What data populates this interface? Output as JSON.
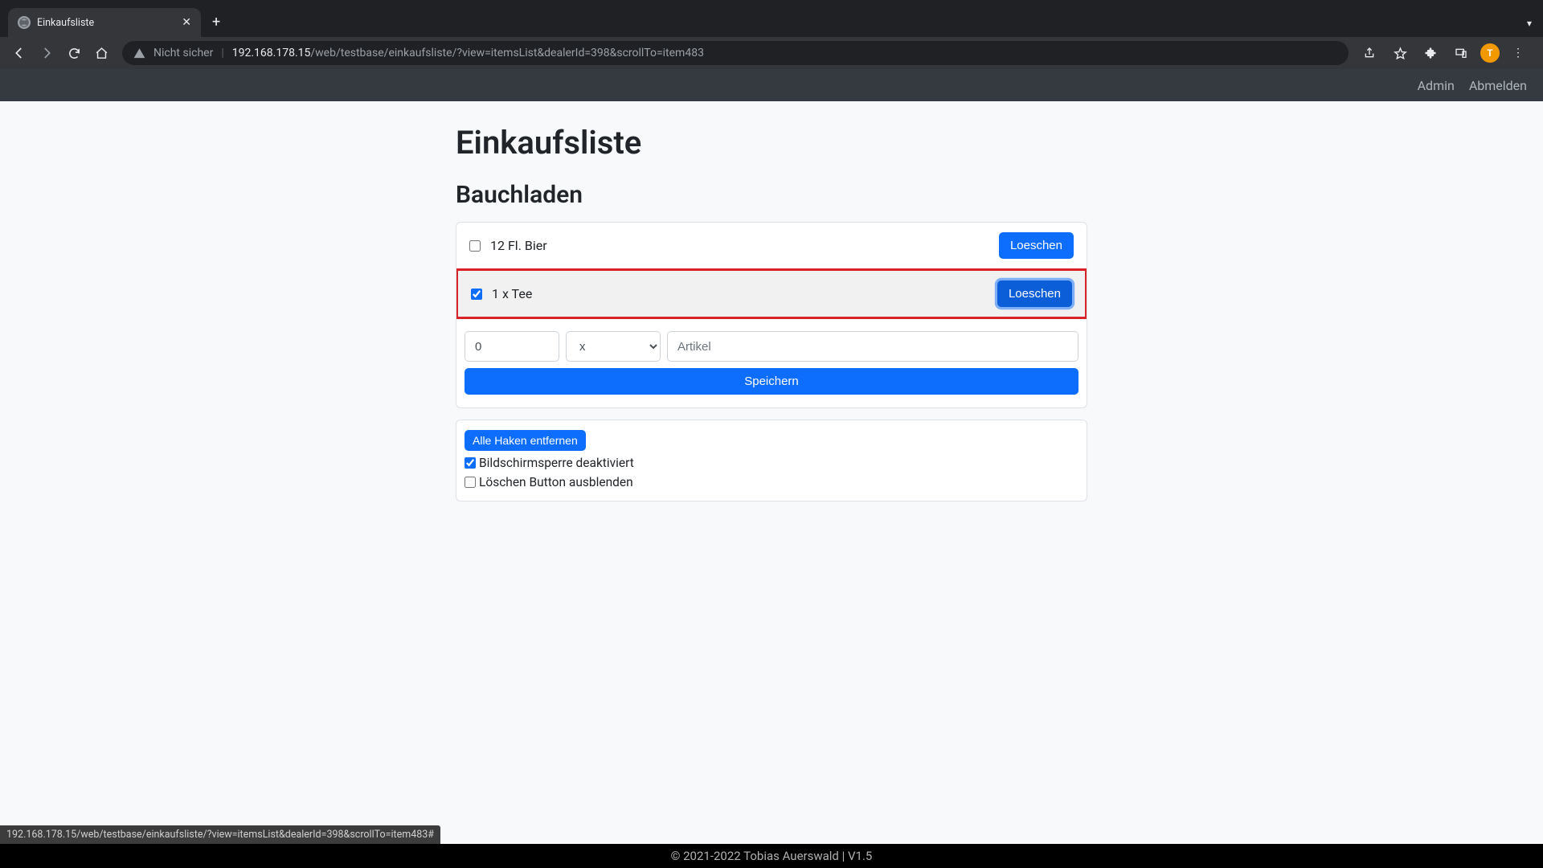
{
  "browser": {
    "tab_title": "Einkaufsliste",
    "insecure_label": "Nicht sicher",
    "url_host": "192.168.178.15",
    "url_path": "/web/testbase/einkaufsliste/?view=itemsList&dealerId=398&scrollTo=item483",
    "status_url": "192.168.178.15/web/testbase/einkaufsliste/?view=itemsList&dealerId=398&scrollTo=item483#",
    "avatar_initial": "T"
  },
  "appbar": {
    "admin": "Admin",
    "logout": "Abmelden"
  },
  "page": {
    "title": "Einkaufsliste",
    "store": "Bauchladen"
  },
  "items": [
    {
      "label": "12 Fl. Bier",
      "checked": false,
      "delete": "Loeschen",
      "highlight": false
    },
    {
      "label": "1 x Tee",
      "checked": true,
      "delete": "Loeschen",
      "highlight": true
    }
  ],
  "form": {
    "qty_value": "0",
    "unit_value": "x",
    "article_placeholder": "Artikel",
    "save": "Speichern"
  },
  "options": {
    "clear_all": "Alle Haken entfernen",
    "screenlock_disabled_label": "Bildschirmsperre deaktiviert",
    "screenlock_disabled_checked": true,
    "hide_delete_label": "Löschen Button ausblenden",
    "hide_delete_checked": false
  },
  "footer": {
    "text": "© 2021-2022 Tobias Auerswald | V1.5"
  }
}
